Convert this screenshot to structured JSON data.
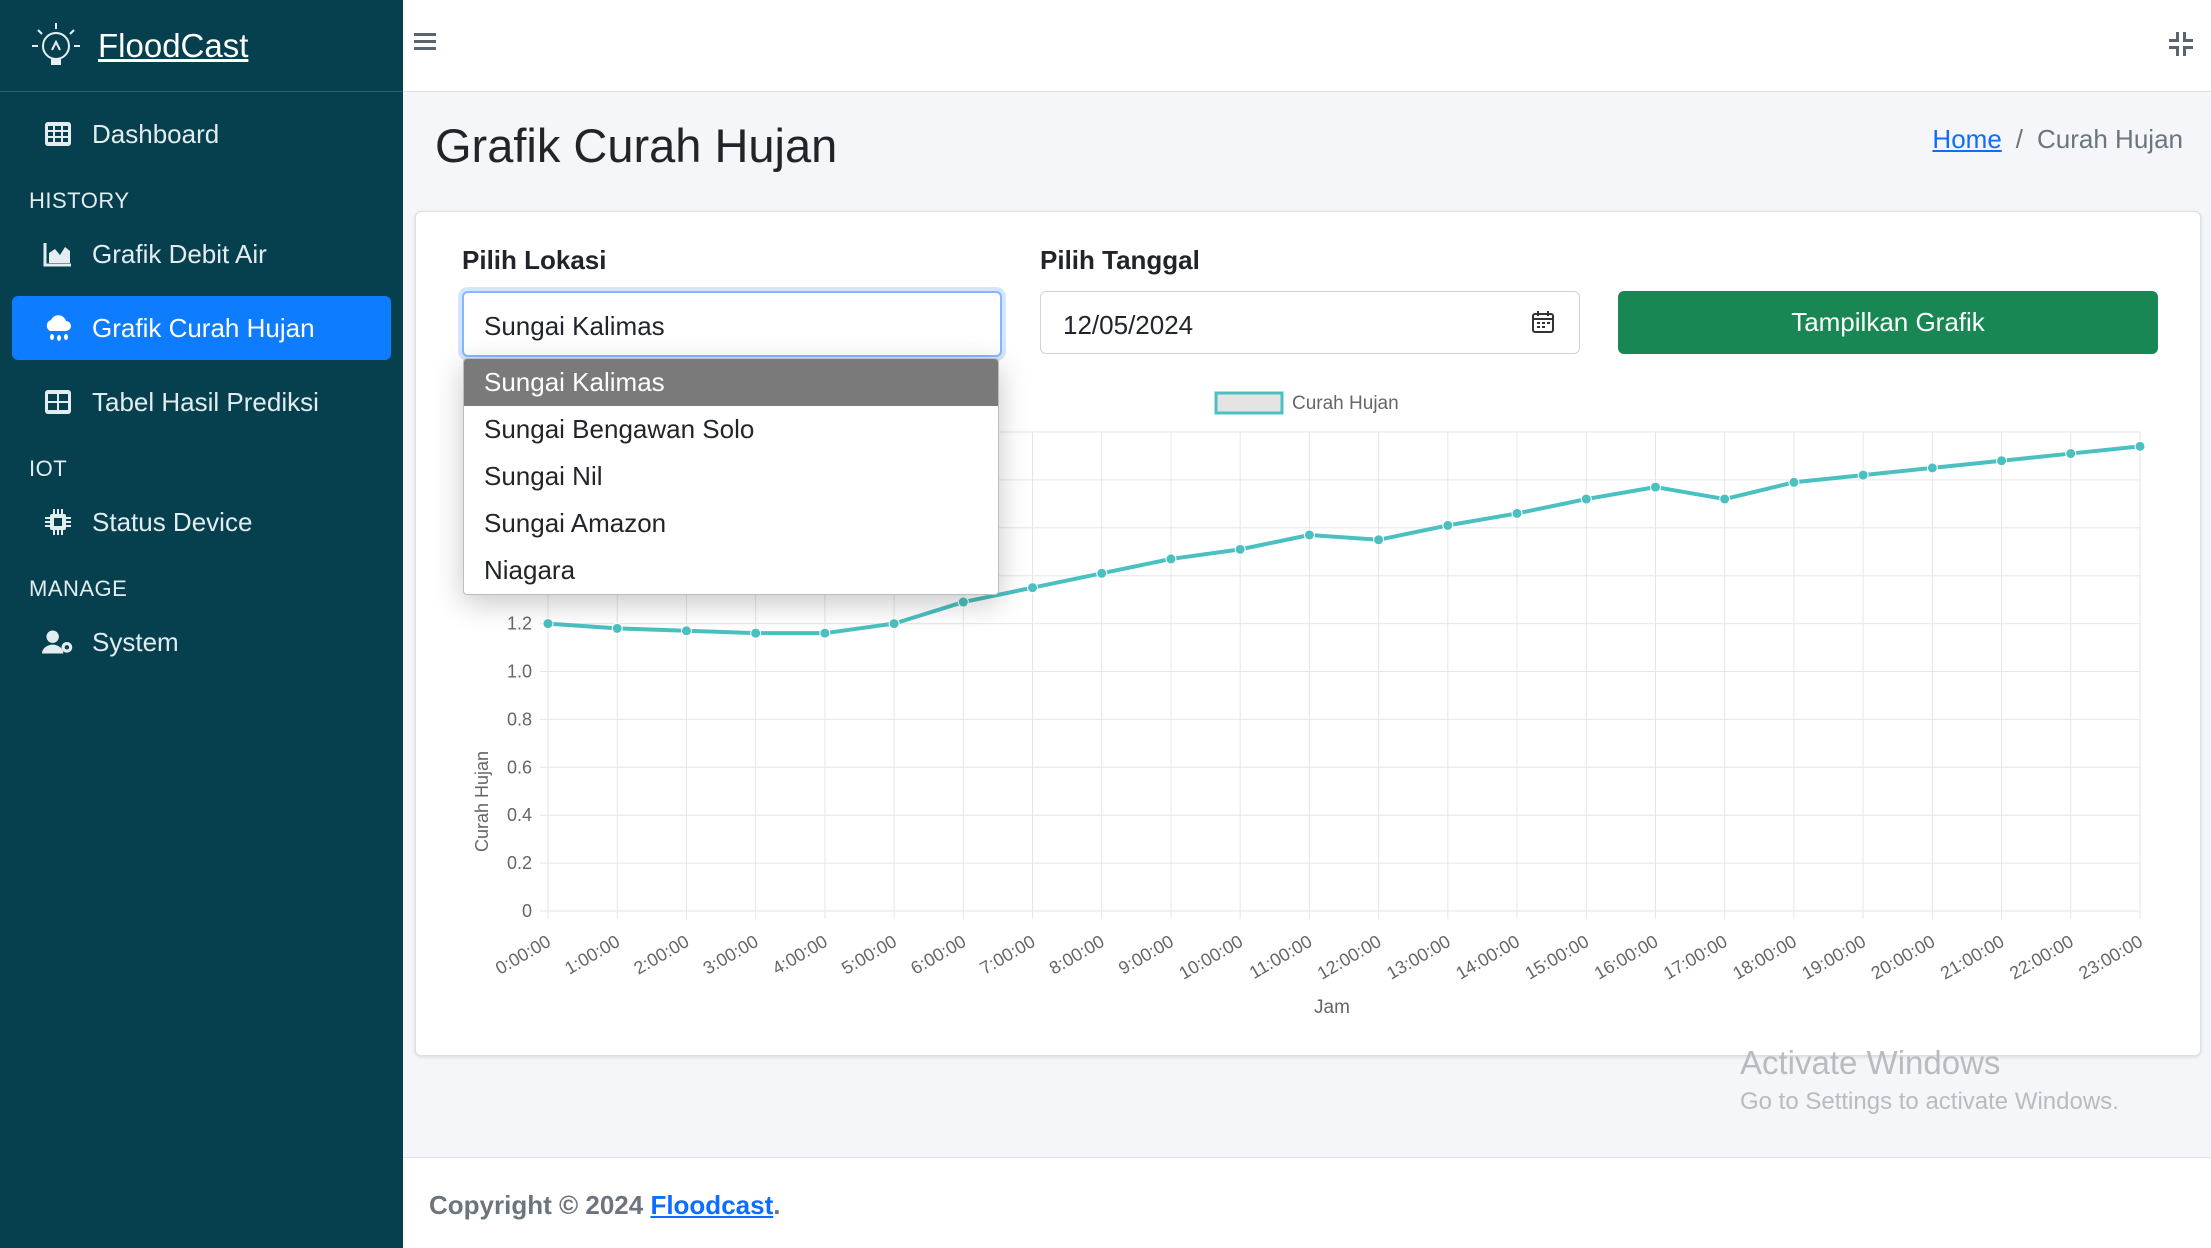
{
  "brand": {
    "name": "FloodCast"
  },
  "sidebar": {
    "items": [
      {
        "label": "Dashboard",
        "icon": "table-grid-icon"
      },
      {
        "header": "HISTORY"
      },
      {
        "label": "Grafik Debit Air",
        "icon": "area-chart-icon"
      },
      {
        "label": "Grafik Curah Hujan",
        "icon": "cloud-rain-icon",
        "active": true
      },
      {
        "label": "Tabel Hasil Prediksi",
        "icon": "table-icon"
      },
      {
        "header": "IOT"
      },
      {
        "label": "Status Device",
        "icon": "microchip-icon"
      },
      {
        "header": "MANAGE"
      },
      {
        "label": "System",
        "icon": "user-gear-icon"
      }
    ]
  },
  "page": {
    "title": "Grafik Curah Hujan",
    "breadcrumb": {
      "home": "Home",
      "separator": "/",
      "current": "Curah Hujan"
    }
  },
  "form": {
    "location_label": "Pilih Lokasi",
    "location_value": "Sungai Kalimas",
    "location_options": [
      "Sungai Kalimas",
      "Sungai Bengawan Solo",
      "Sungai Nil",
      "Sungai Amazon",
      "Niagara"
    ],
    "date_label": "Pilih Tanggal",
    "date_value": "12/05/2024",
    "submit_label": "Tampilkan Grafik"
  },
  "chart_data": {
    "type": "line",
    "xlabel": "Jam",
    "ylabel": "Curah Hujan",
    "series": [
      {
        "name": "Curah Hujan",
        "color": "#4bc0c0",
        "values": [
          1.2,
          1.18,
          1.17,
          1.16,
          1.16,
          1.2,
          1.29,
          1.35,
          1.41,
          1.47,
          1.51,
          1.57,
          1.55,
          1.61,
          1.66,
          1.72,
          1.77,
          1.72,
          1.79,
          1.82,
          1.85,
          1.88,
          1.91,
          1.94
        ]
      }
    ],
    "categories": [
      "0:00:00",
      "1:00:00",
      "2:00:00",
      "3:00:00",
      "4:00:00",
      "5:00:00",
      "6:00:00",
      "7:00:00",
      "8:00:00",
      "9:00:00",
      "10:00:00",
      "11:00:00",
      "12:00:00",
      "13:00:00",
      "14:00:00",
      "15:00:00",
      "16:00:00",
      "17:00:00",
      "18:00:00",
      "19:00:00",
      "20:00:00",
      "21:00:00",
      "22:00:00",
      "23:00:00"
    ],
    "ylim": [
      0,
      2.0
    ],
    "yticks": [
      0,
      0.2,
      0.4,
      0.6,
      0.8,
      1.0,
      1.2
    ],
    "ytick_labels": [
      "0",
      "0.2",
      "0.4",
      "0.6",
      "0.8",
      "1.0",
      "1.2"
    ],
    "grid": true,
    "legend": "top"
  },
  "footer": {
    "prefix": "Copyright © 2024 ",
    "link": "Floodcast",
    "suffix": "."
  },
  "watermark": {
    "line1": "Activate Windows",
    "line2": "Go to Settings to activate Windows."
  },
  "colors": {
    "sidebar": "#06404f",
    "active": "#0d7cff",
    "button": "#198754",
    "link": "#0d6efd"
  }
}
